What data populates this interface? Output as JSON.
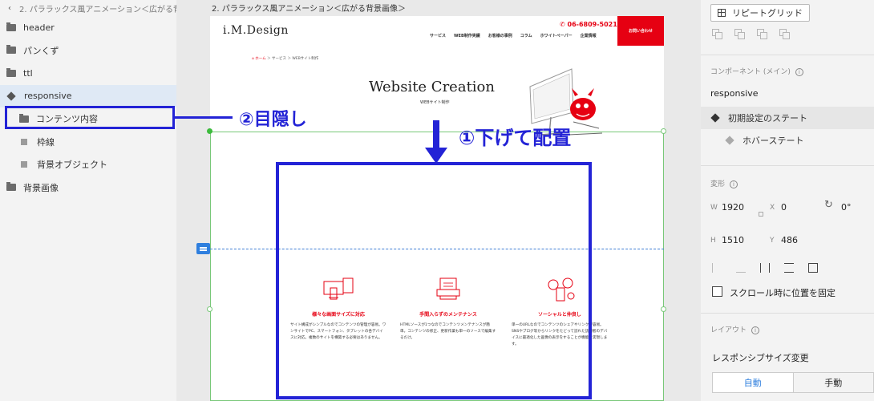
{
  "left_panel": {
    "breadcrumb": "2. パララックス風アニメーション＜広がる背...",
    "layers": [
      {
        "label": "header"
      },
      {
        "label": "パンくず"
      },
      {
        "label": "ttl"
      },
      {
        "label": "responsive"
      },
      {
        "label": "コンテンツ内容"
      },
      {
        "label": "枠線"
      },
      {
        "label": "背景オブジェクト"
      },
      {
        "label": "背景画像"
      }
    ]
  },
  "canvas": {
    "artboard_title": "2. パララックス風アニメーション＜広がる背景画像＞",
    "site": {
      "logo": "i.M.Design",
      "phone": "06-6809-5021",
      "nav": [
        "サービス",
        "WEB制作実績",
        "お客様の事例",
        "コラム",
        "ホワイトペーパー",
        "企業情報"
      ],
      "contact": "お問い合わせ",
      "breadcrumb": [
        "ホーム",
        "サービス",
        "WEBサイト制作"
      ],
      "hero_title": "Website Creation",
      "hero_subtitle": "WEBサイト制作",
      "features": [
        {
          "title": "様々な画面サイズに対応",
          "desc": "サイト構成がシンプルなのでコンテンツの管理が容易。ワンサイトでPC、スマートフォン、タブレットの各デバイスに対応。複数のサイトを構築する必要はありません。"
        },
        {
          "title": "手間入らずのメンテナンス",
          "desc": "HTMLソースが1つなのでコンテンツメンテナンスが簡単。コンテンツの修正、更新作業も単一のソースで編集するだけ。"
        },
        {
          "title": "ソーシャルと仲良し",
          "desc": "単一のURLなのでコンテンツのシェアやリンクが容易。SNSやブログ等からリンクをたどって訪れた訪問者のデバイスに最適化した画像の表示をすることが機能を実現します。"
        }
      ]
    },
    "annotations": {
      "label_hide": "②目隠し",
      "label_place": "①下げて配置"
    }
  },
  "right_panel": {
    "repeat_grid_label": "リピートグリッド",
    "component_heading": "コンポーネント (メイン)",
    "component_name": "responsive",
    "default_state": "初期設定のステート",
    "hover_state": "ホバーステート",
    "transform_heading": "変形",
    "w_label": "W",
    "w_value": "1920",
    "x_label": "X",
    "x_value": "0",
    "rotation_value": "0°",
    "h_label": "H",
    "h_value": "1510",
    "y_label": "Y",
    "y_value": "486",
    "fix_scroll_label": "スクロール時に位置を固定",
    "layout_heading": "レイアウト",
    "responsive_resize_label": "レスポンシブサイズ変更",
    "mode_auto": "自動",
    "mode_manual": "手動"
  },
  "colors": {
    "annotation_blue": "#2323d6",
    "selection_green": "#79c879",
    "brand_red": "#e60012",
    "guide_blue": "#3f7fd6"
  }
}
